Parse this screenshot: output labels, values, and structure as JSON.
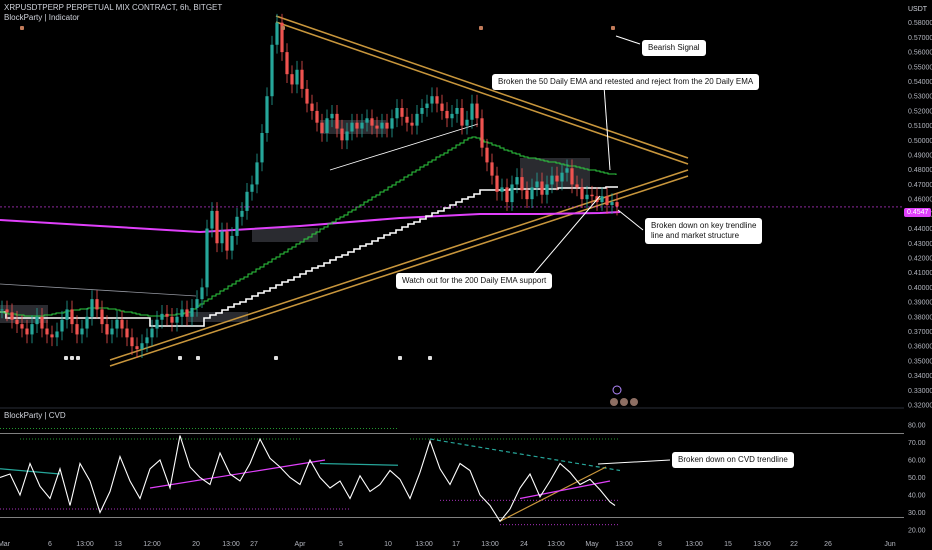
{
  "header": {
    "symbol_line": "XRPUSDTPERP PERPETUAL MIX CONTRACT, 6h, BITGET",
    "indicator_line": "BlockParty | Indicator",
    "sub_indicator": "BlockParty | CVD",
    "currency": "USDT"
  },
  "colors": {
    "background": "#000000",
    "price_line": "#ffffff",
    "ema_200": "#e040fb",
    "ema_50": "#ffffff",
    "ema_20": "#2ecc40",
    "trendline": "#c8963c",
    "cvd_line": "#ffffff",
    "last_price_badge": "#e040fb"
  },
  "callouts": {
    "bearish": "Bearish Signal",
    "ema_break": "Broken the 50 Daily EMA and retested and reject from the 20 Daily EMA",
    "trendline_break_1": "Broken down on key trendline",
    "trendline_break_2": "line and market structure",
    "ema200": "Watch out for the 200 Daily EMA support",
    "cvd_break": "Broken down on CVD trendline"
  },
  "chart_data": [
    {
      "type": "line",
      "name": "price",
      "ylim": [
        0.32,
        0.59
      ],
      "yticks": [
        "0.58000",
        "0.57000",
        "0.56000",
        "0.55000",
        "0.54000",
        "0.53000",
        "0.52000",
        "0.51000",
        "0.50000",
        "0.49000",
        "0.48000",
        "0.47000",
        "0.46000",
        "0.45000",
        "0.44000",
        "0.43000",
        "0.42000",
        "0.41000",
        "0.40000",
        "0.39000",
        "0.38000",
        "0.37000",
        "0.36000",
        "0.35000",
        "0.34000",
        "0.33000",
        "0.32000"
      ],
      "last_price": "0.4547",
      "xtick_labels": [
        "Mar",
        "6",
        "13:00",
        "13",
        "12:00",
        "20",
        "13:00",
        "27",
        "Apr",
        "5",
        "10",
        "13:00",
        "17",
        "13:00",
        "24",
        "13:00",
        "May",
        "13:00",
        "8",
        "13:00",
        "15",
        "13:00",
        "22",
        "26",
        "Jun"
      ],
      "x": [
        0,
        5,
        10,
        15,
        20,
        25,
        30,
        35,
        40,
        45,
        50,
        55,
        60,
        65,
        70,
        75,
        80,
        85,
        90,
        95,
        100,
        105,
        110,
        115,
        120,
        125,
        130,
        135,
        140,
        145,
        150,
        155,
        160,
        165,
        170,
        175,
        180,
        185,
        190,
        195,
        200,
        205,
        210,
        215,
        220,
        225,
        230,
        235,
        240,
        245,
        250,
        255,
        260,
        265,
        270,
        275,
        280,
        285,
        290,
        295,
        300,
        305,
        310,
        315,
        320,
        325,
        330,
        335,
        340,
        345,
        350,
        355,
        360,
        365,
        370,
        375,
        380,
        385,
        390,
        395,
        400,
        405,
        410,
        415,
        420,
        425,
        430,
        435,
        440,
        445,
        450,
        455,
        460,
        465,
        470,
        475,
        480,
        485,
        490,
        495,
        500,
        505,
        510,
        515,
        520,
        525,
        530,
        535,
        540,
        545,
        550,
        555,
        560,
        565,
        570,
        575,
        580,
        585,
        590,
        595,
        600,
        605,
        610,
        615
      ],
      "close": [
        0.385,
        0.383,
        0.378,
        0.375,
        0.372,
        0.368,
        0.375,
        0.38,
        0.372,
        0.368,
        0.366,
        0.37,
        0.378,
        0.385,
        0.375,
        0.368,
        0.372,
        0.38,
        0.392,
        0.385,
        0.375,
        0.368,
        0.372,
        0.378,
        0.372,
        0.366,
        0.36,
        0.358,
        0.362,
        0.366,
        0.372,
        0.378,
        0.382,
        0.38,
        0.376,
        0.38,
        0.385,
        0.38,
        0.386,
        0.392,
        0.4,
        0.44,
        0.452,
        0.43,
        0.438,
        0.425,
        0.435,
        0.448,
        0.452,
        0.465,
        0.47,
        0.485,
        0.505,
        0.53,
        0.565,
        0.58,
        0.56,
        0.545,
        0.538,
        0.548,
        0.535,
        0.525,
        0.52,
        0.512,
        0.505,
        0.515,
        0.518,
        0.508,
        0.5,
        0.506,
        0.512,
        0.508,
        0.512,
        0.515,
        0.51,
        0.508,
        0.512,
        0.508,
        0.515,
        0.522,
        0.516,
        0.512,
        0.51,
        0.518,
        0.522,
        0.525,
        0.53,
        0.525,
        0.52,
        0.515,
        0.518,
        0.522,
        0.51,
        0.514,
        0.525,
        0.515,
        0.495,
        0.485,
        0.476,
        0.465,
        0.468,
        0.458,
        0.47,
        0.475,
        0.466,
        0.46,
        0.468,
        0.472,
        0.463,
        0.47,
        0.476,
        0.472,
        0.478,
        0.481,
        0.47,
        0.468,
        0.46,
        0.463,
        0.462,
        0.458,
        0.462,
        0.456,
        0.458,
        0.455
      ]
    },
    {
      "type": "line",
      "name": "",
      "ylim": [
        20,
        80
      ],
      "yticks": [
        "80.00",
        "70.00",
        "60.00",
        "50.00",
        "40.00",
        "30.00",
        "20.00"
      ],
      "x": [
        0,
        10,
        20,
        30,
        40,
        50,
        60,
        70,
        80,
        90,
        100,
        110,
        120,
        130,
        140,
        150,
        160,
        170,
        180,
        190,
        200,
        210,
        220,
        230,
        240,
        250,
        260,
        270,
        280,
        290,
        300,
        310,
        320,
        330,
        340,
        350,
        360,
        370,
        380,
        390,
        400,
        410,
        420,
        430,
        440,
        450,
        460,
        470,
        480,
        490,
        500,
        510,
        520,
        530,
        540,
        550,
        560,
        570,
        580,
        590,
        600,
        610,
        615
      ],
      "values": [
        50,
        52,
        40,
        58,
        45,
        38,
        55,
        34,
        58,
        48,
        30,
        42,
        62,
        48,
        38,
        55,
        60,
        44,
        74,
        56,
        50,
        46,
        64,
        52,
        48,
        58,
        72,
        61,
        56,
        50,
        46,
        60,
        50,
        44,
        48,
        38,
        51,
        42,
        46,
        54,
        49,
        38,
        53,
        71,
        55,
        46,
        58,
        54,
        40,
        34,
        25,
        32,
        44,
        52,
        39,
        48,
        58,
        53,
        46,
        49,
        43,
        36,
        34
      ]
    }
  ]
}
